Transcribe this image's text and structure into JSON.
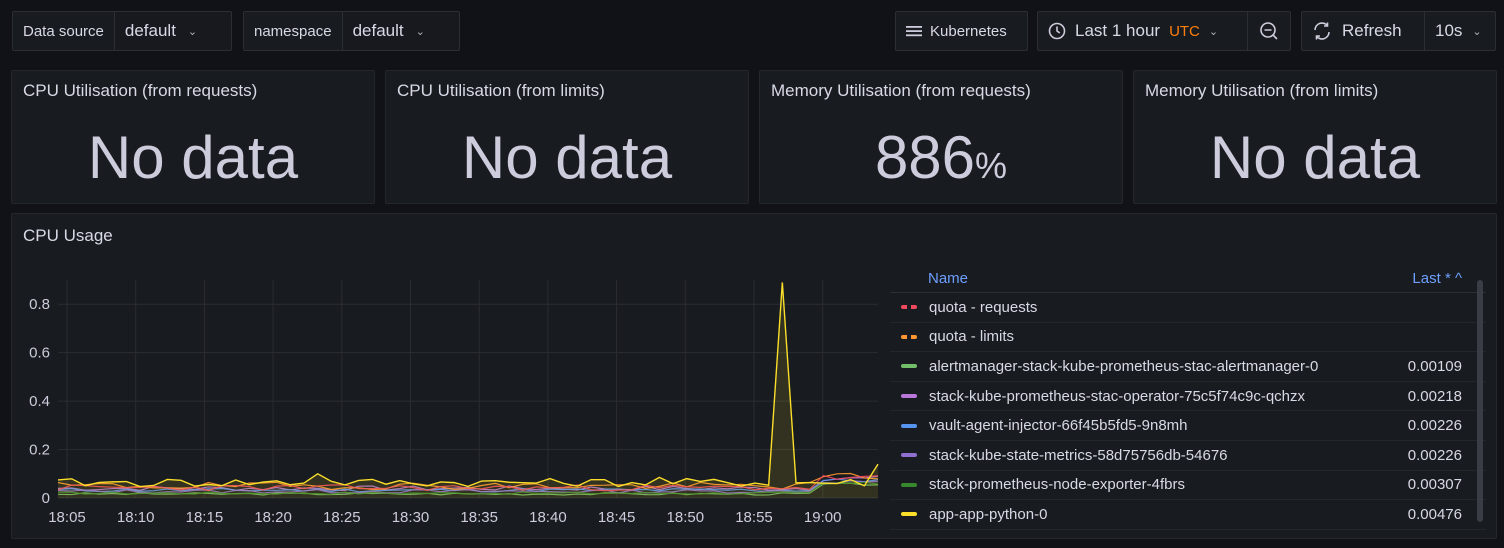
{
  "toolbar": {
    "datasource_label": "Data source",
    "datasource_value": "default",
    "namespace_label": "namespace",
    "namespace_value": "default",
    "kubernetes_label": "Kubernetes",
    "time_range": "Last 1 hour",
    "timezone": "UTC",
    "refresh_label": "Refresh",
    "refresh_interval": "10s"
  },
  "stats": [
    {
      "title": "CPU Utilisation (from requests)",
      "value": "No data",
      "unit": ""
    },
    {
      "title": "CPU Utilisation (from limits)",
      "value": "No data",
      "unit": ""
    },
    {
      "title": "Memory Utilisation (from requests)",
      "value": "886",
      "unit": "%"
    },
    {
      "title": "Memory Utilisation (from limits)",
      "value": "No data",
      "unit": ""
    }
  ],
  "cpu_panel": {
    "title": "CPU Usage",
    "legend_name_header": "Name",
    "legend_last_header": "Last * ^"
  },
  "colors": {
    "accent": "#6e9fff",
    "timezone": "#ff7f0e"
  },
  "chart_data": {
    "type": "line",
    "x": [
      "18:05",
      "18:10",
      "18:15",
      "18:20",
      "18:25",
      "18:30",
      "18:35",
      "18:40",
      "18:45",
      "18:50",
      "18:55",
      "19:00"
    ],
    "ylim": [
      0,
      0.9
    ],
    "yticks": [
      "0",
      "0.2",
      "0.4",
      "0.6",
      "0.8"
    ],
    "series": [
      {
        "name": "quota - requests",
        "color": "#f2495c",
        "dashed": true,
        "last": ""
      },
      {
        "name": "quota - limits",
        "color": "#ff9830",
        "dashed": true,
        "last": ""
      },
      {
        "name": "alertmanager-stack-kube-prometheus-stac-alertmanager-0",
        "color": "#73bf69",
        "last": "0.00109"
      },
      {
        "name": "stack-kube-prometheus-stac-operator-75c5f74c9c-qchzx",
        "color": "#b877d9",
        "last": "0.00218"
      },
      {
        "name": "vault-agent-injector-66f45b5fd5-9n8mh",
        "color": "#5794f2",
        "last": "0.00226"
      },
      {
        "name": "stack-kube-state-metrics-58d75756db-54676",
        "color": "#8f6fd0",
        "last": "0.00226"
      },
      {
        "name": "stack-prometheus-node-exporter-4fbrs",
        "color": "#37872d",
        "last": "0.00307"
      },
      {
        "name": "app-app-python-0",
        "color": "#fade2a",
        "last": "0.00476"
      }
    ]
  }
}
